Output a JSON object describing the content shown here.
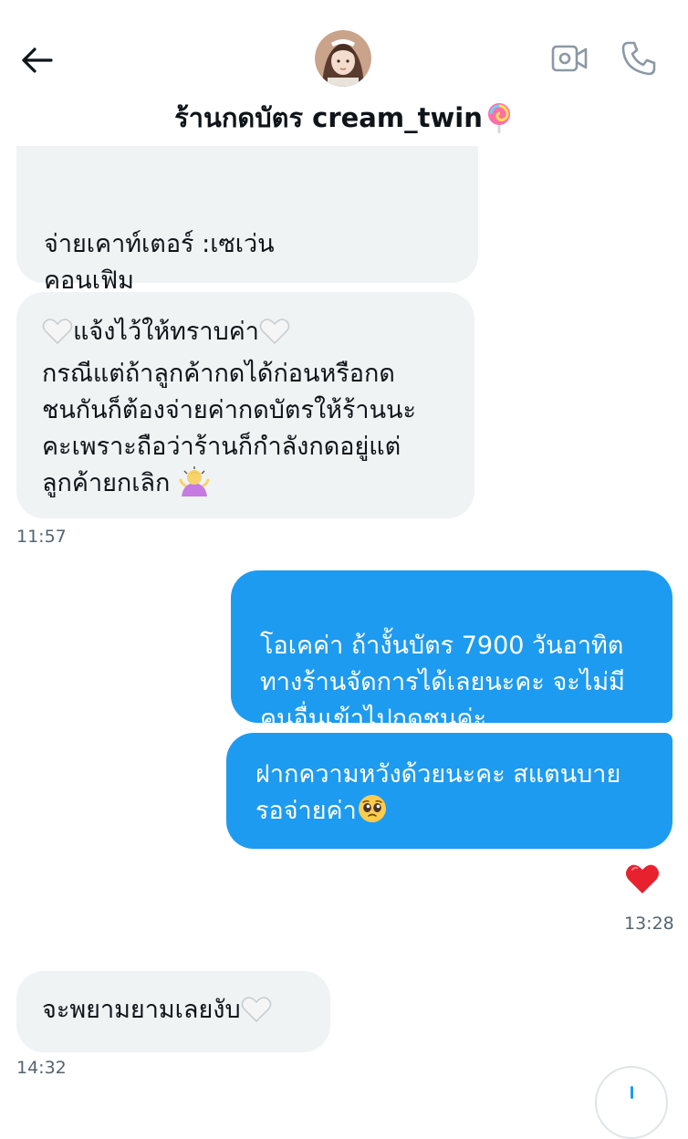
{
  "header": {
    "title": "ร้านกดบัตร cream_twin",
    "title_emoji": "lollipop-icon",
    "back_icon": "back-arrow-icon",
    "video_icon": "video-call-icon",
    "call_icon": "phone-icon"
  },
  "messages": [
    {
      "direction": "incoming",
      "text": "จ่ายเคาท์เตอร์ :เซเว่น\nคอนเฟิม"
    },
    {
      "direction": "incoming",
      "text_line1": "แจ้งไว้ให้ทราบค่า",
      "text_rest": "กรณีแต่ถ้าลูกค้ากดได้ก่อนหรือกด\nชนกันก็ต้องจ่ายค่ากดบัตรให้ร้านนะ\nคะเพราะถือว่าร้านก็กำลังกดอยู่แต่\nลูกค้ายกเลิก ",
      "emojis": [
        "white-heart-icon",
        "white-heart-icon",
        "person-bowing-icon"
      ],
      "time": "11:57"
    },
    {
      "direction": "outgoing",
      "text": "โอเคค่า ถ้างั้นบัตร 7900 วันอาทิต\nทางร้านจัดการได้เลยนะคะ จะไม่มี\nคนอื่นเข้าไปกดชนค่ะ"
    },
    {
      "direction": "outgoing",
      "text": "ฝากความหวังด้วยนะคะ สแตนบาย\nรอจ่ายค่า",
      "emoji": "pleading-face-icon",
      "reaction": "red-heart-icon",
      "time": "13:28"
    },
    {
      "direction": "incoming",
      "text": "จะพยามยามเลยงับ",
      "emoji": "white-heart-icon",
      "time": "14:32"
    }
  ],
  "colors": {
    "outgoing_bubble": "#1d9bf0",
    "incoming_bubble": "#eff3f4",
    "timestamp": "#536471",
    "text": "#0f1419"
  }
}
